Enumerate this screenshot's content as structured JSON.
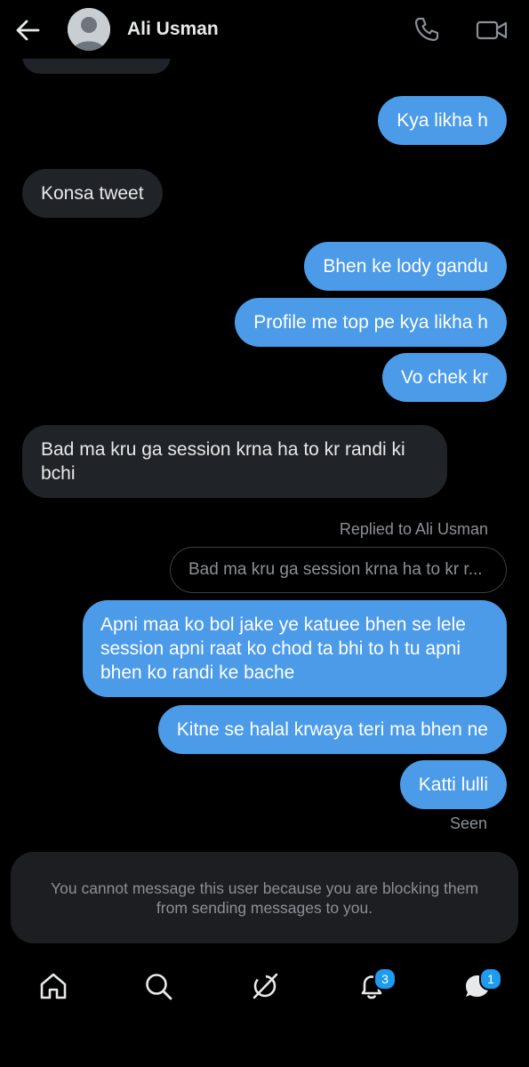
{
  "header": {
    "contact_name": "Ali Usman",
    "back_icon": "arrow-left-icon",
    "call_icon": "phone-icon",
    "video_icon": "video-camera-icon"
  },
  "messages": [
    {
      "direction": "outgoing",
      "text": "Kya likha h"
    },
    {
      "direction": "incoming",
      "text": "Konsa tweet"
    },
    {
      "direction": "outgoing",
      "text": "Bhen ke lody gandu"
    },
    {
      "direction": "outgoing",
      "text": "Profile me top pe kya likha h"
    },
    {
      "direction": "outgoing",
      "text": "Vo chek kr"
    },
    {
      "direction": "incoming",
      "text": "Bad ma kru ga session krna ha to kr randi ki bchi"
    },
    {
      "direction": "outgoing",
      "text": "Apni maa ko bol jake ye katuee bhen se lele session apni raat ko chod ta bhi to h tu apni bhen ko randi ke bache"
    },
    {
      "direction": "outgoing",
      "text": "Kitne se halal krwaya teri ma bhen ne"
    },
    {
      "direction": "outgoing",
      "text": "Katti lulli"
    }
  ],
  "reply": {
    "label": "Replied to Ali Usman",
    "preview": "Bad ma kru ga session krna ha to kr r..."
  },
  "status": {
    "seen": "Seen"
  },
  "blocked_notice": "You cannot message this user because you are blocking them from sending messages to you.",
  "nav": {
    "items": [
      {
        "icon": "home-icon"
      },
      {
        "icon": "search-icon"
      },
      {
        "icon": "grok-icon"
      },
      {
        "icon": "bell-icon",
        "badge": "3"
      },
      {
        "icon": "messages-icon",
        "badge": "1"
      }
    ]
  },
  "colors": {
    "background": "#000000",
    "outgoing_bubble": "#4c9be8",
    "incoming_bubble": "#202327",
    "badge": "#1d9bf0"
  }
}
